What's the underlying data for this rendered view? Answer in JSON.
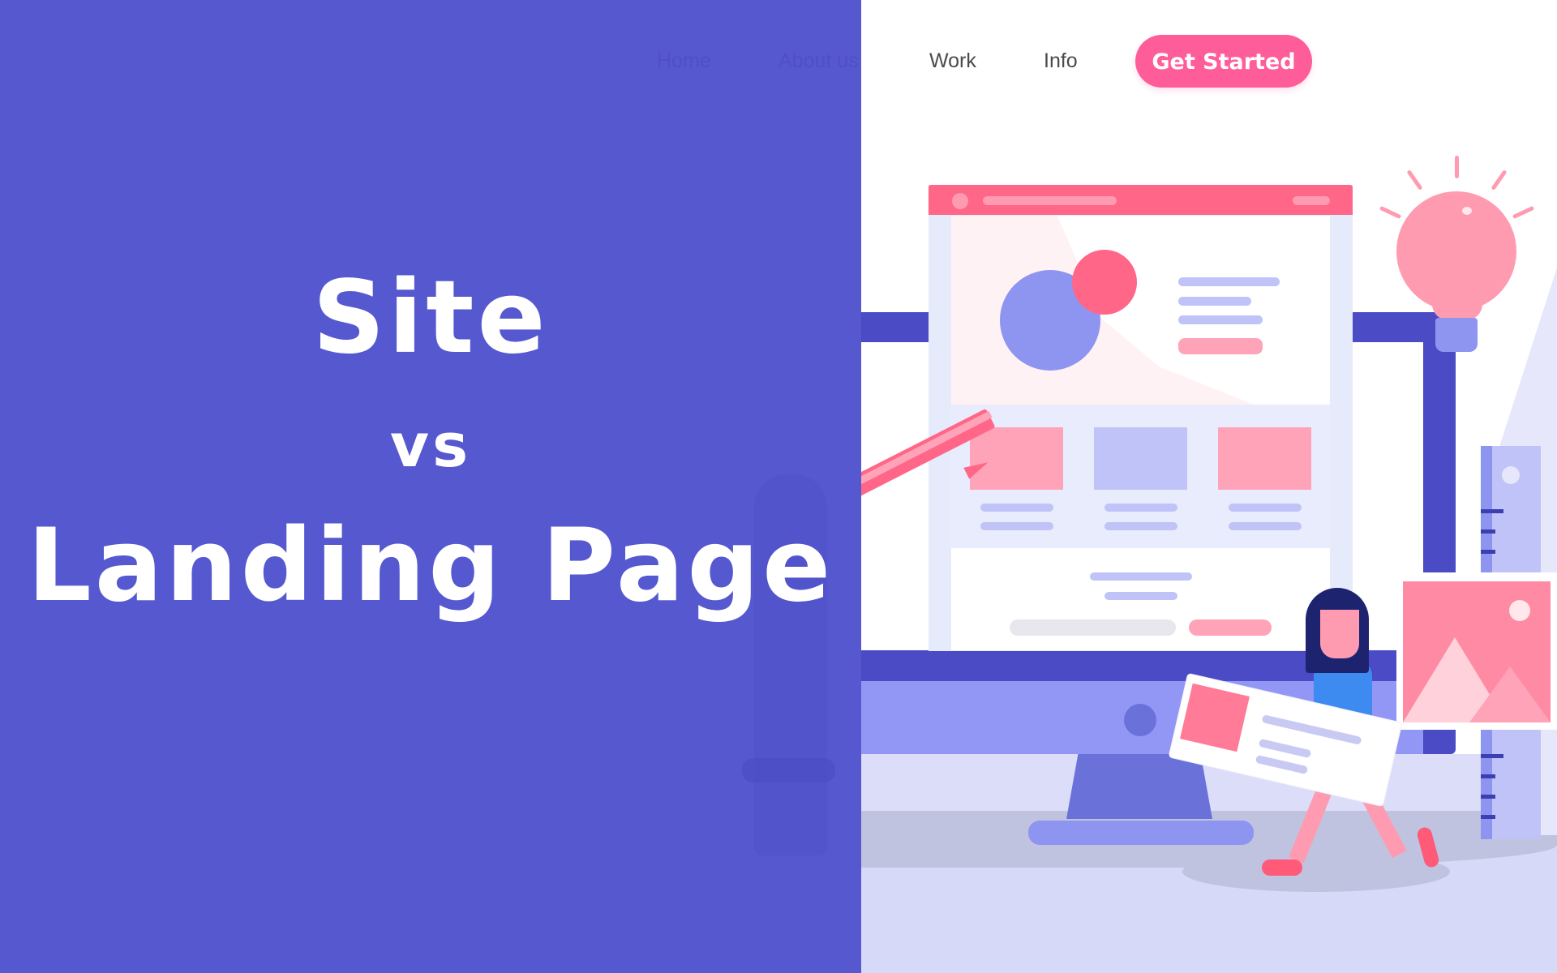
{
  "nav": {
    "items": [
      {
        "label": "Home"
      },
      {
        "label": "About us"
      },
      {
        "label": "Work"
      },
      {
        "label": "Info"
      }
    ],
    "cta_label": "Get Started"
  },
  "hero": {
    "line1": "Site",
    "line2": "vs",
    "line3": "Landing Page"
  },
  "colors": {
    "overlay": "#5558CF",
    "accent_pink": "#FF5C9A",
    "browser_header": "#FF6687",
    "monitor_frame": "#4A4BC5",
    "text_on_overlay": "#FFFFFF"
  },
  "illustration": {
    "icons": [
      "lightbulb-icon",
      "pencil-icon",
      "image-placeholder-icon",
      "ruler-icon",
      "monitor-icon"
    ]
  }
}
